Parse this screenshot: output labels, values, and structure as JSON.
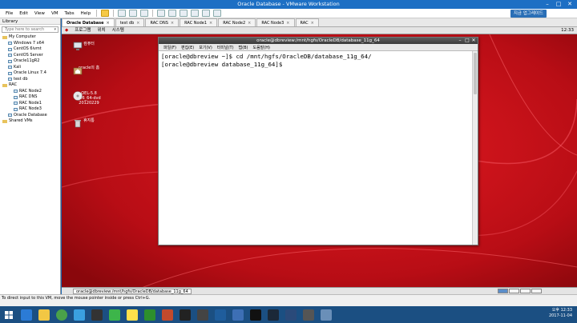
{
  "window": {
    "title": "Oracle Database - VMware Workstation"
  },
  "menubar": {
    "items": [
      "File",
      "Edit",
      "View",
      "VM",
      "Tabs",
      "Help"
    ],
    "upgrade_label": "지금 업그레이드"
  },
  "library": {
    "header": "Library",
    "search_placeholder": "Type here to search",
    "tree": [
      {
        "label": "My Computer",
        "level": 0,
        "kind": "folder"
      },
      {
        "label": "Windows 7 x64",
        "level": 1,
        "kind": "vm"
      },
      {
        "label": "CentOS 6ivmt",
        "level": 1,
        "kind": "vm"
      },
      {
        "label": "CentOS Server",
        "level": 1,
        "kind": "vm"
      },
      {
        "label": "Oracle11gR2",
        "level": 1,
        "kind": "vm"
      },
      {
        "label": "Kali",
        "level": 1,
        "kind": "vm"
      },
      {
        "label": "Oracle Linux 7.4",
        "level": 1,
        "kind": "vm"
      },
      {
        "label": "test db",
        "level": 1,
        "kind": "vm"
      },
      {
        "label": "RAC",
        "level": 0,
        "kind": "folder"
      },
      {
        "label": "RAC Node2",
        "level": 2,
        "kind": "vm"
      },
      {
        "label": "RAC DNS",
        "level": 2,
        "kind": "vm"
      },
      {
        "label": "RAC Node1",
        "level": 2,
        "kind": "vm"
      },
      {
        "label": "RAC Node3",
        "level": 2,
        "kind": "vm"
      },
      {
        "label": "Oracle Database",
        "level": 1,
        "kind": "vm"
      },
      {
        "label": "Shared VMs",
        "level": 0,
        "kind": "folder"
      }
    ]
  },
  "vm_tabs": [
    {
      "label": "Oracle Database",
      "active": true
    },
    {
      "label": "test db",
      "active": false
    },
    {
      "label": "RAC DNS",
      "active": false
    },
    {
      "label": "RAC Node1",
      "active": false
    },
    {
      "label": "RAC Node2",
      "active": false
    },
    {
      "label": "RAC Node3",
      "active": false
    },
    {
      "label": "RAC",
      "active": false
    }
  ],
  "guest": {
    "panel_items": [
      "프로그램",
      "위치",
      "시스템"
    ],
    "clock": "12:33",
    "desktop_icons": [
      {
        "label": "컴퓨터",
        "icon": "computer-icon"
      },
      {
        "label": "oracle의 홈",
        "icon": "home-folder-icon"
      },
      {
        "label": "OEL-5.8 x86_64-dvd 20120229",
        "icon": "dvd-icon"
      },
      {
        "label": "휴지통",
        "icon": "trash-icon"
      }
    ],
    "taskbar_item": "oracle@dbreview:/mnt/hgfs/OracleDB/database_11g_64"
  },
  "terminal": {
    "title": "oracle@dbreview:/mnt/hgfs/OracleDB/database_11g_64",
    "menu": [
      "파일(F)",
      "편집(E)",
      "보기(V)",
      "터미널(T)",
      "탭(B)",
      "도움말(H)"
    ],
    "lines": [
      "[oracle@dbreview ~]$ cd /mnt/hgfs/OracleDB/database_11g_64/",
      "[oracle@dbreview database_11g_64]$ "
    ]
  },
  "status": {
    "text": "To direct input to this VM, move the mouse pointer inside or press Ctrl+G."
  },
  "host_taskbar": {
    "clock_time": "오후 12:33",
    "clock_date": "2017-11-04"
  },
  "colors": {
    "guest_bg": "#c8101a",
    "host_taskbar": "#1b4f82",
    "title_bar": "#1d6fc4"
  }
}
